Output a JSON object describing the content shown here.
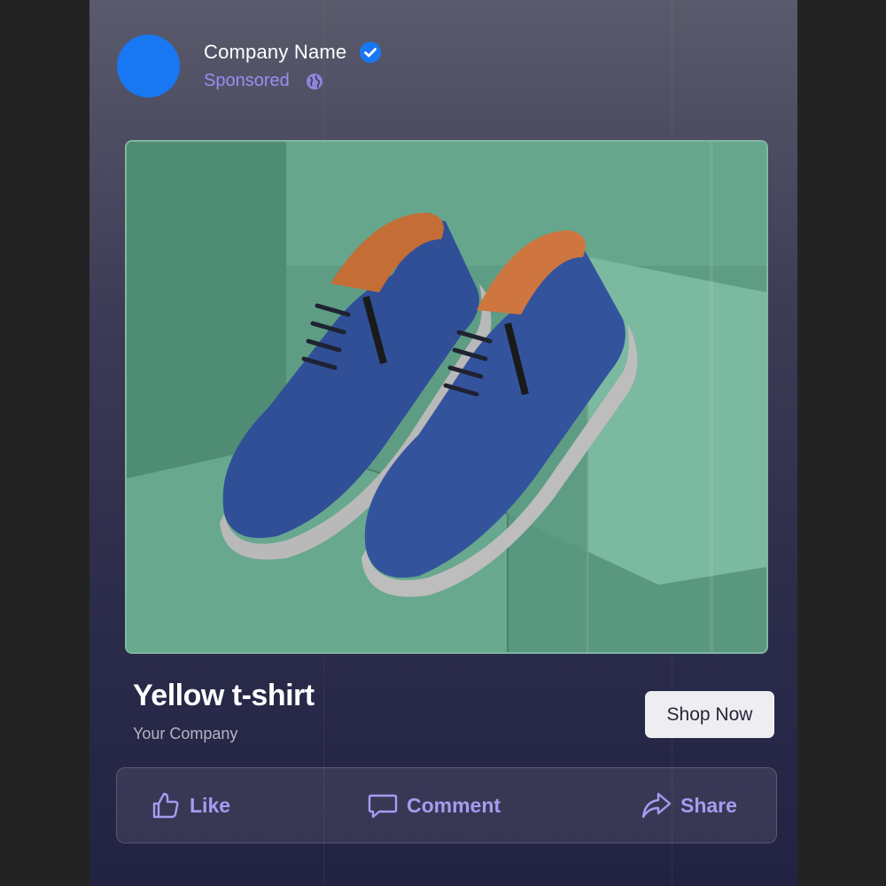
{
  "post": {
    "company_name": "Company Name",
    "sponsored_label": "Sponsored",
    "verified_icon": "verified-badge-icon",
    "privacy_icon": "globe-icon"
  },
  "ad": {
    "title": "Yellow t-shirt",
    "subtitle": "Your Company",
    "cta_label": "Shop Now"
  },
  "actions": {
    "like": {
      "label": "Like",
      "icon": "thumbs-up-icon"
    },
    "comment": {
      "label": "Comment",
      "icon": "speech-bubble-icon"
    },
    "share": {
      "label": "Share",
      "icon": "share-arrow-icon"
    }
  },
  "colors": {
    "avatar": "#1877f2",
    "accent": "#9c8cf4",
    "action_text": "#a79bf0",
    "cta_bg": "#eeeef2"
  }
}
